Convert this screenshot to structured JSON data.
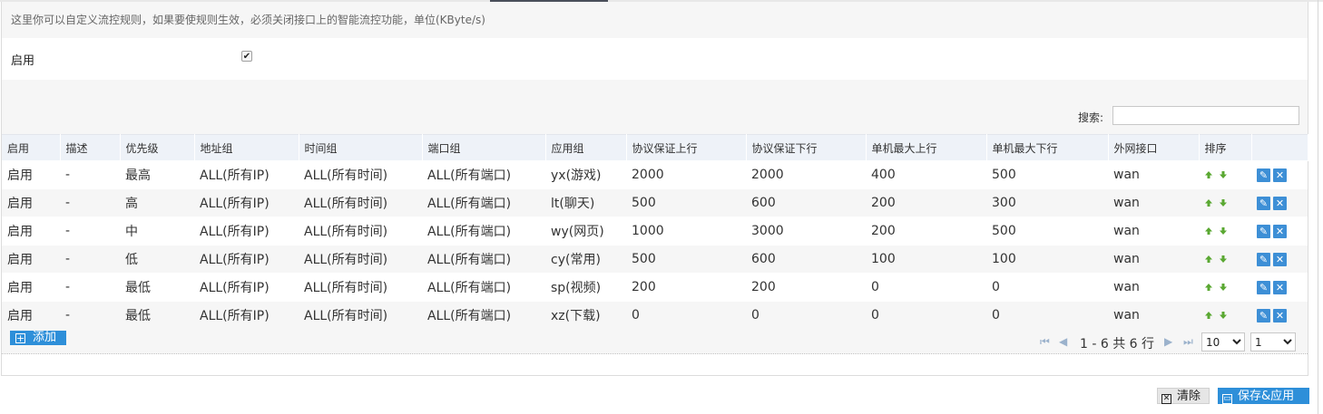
{
  "description": "这里你可以自定义流控规则，如果要使规则生效，必须关闭接口上的智能流控功能，单位(KByte/s)",
  "enable": {
    "label": "启用",
    "checked": true
  },
  "search": {
    "label": "搜索:",
    "value": ""
  },
  "table": {
    "headers": [
      "启用",
      "描述",
      "优先级",
      "地址组",
      "时间组",
      "端口组",
      "应用组",
      "协议保证上行",
      "协议保证下行",
      "单机最大上行",
      "单机最大下行",
      "外网接口",
      "排序"
    ],
    "rows": [
      [
        "启用",
        "-",
        "最高",
        "ALL(所有IP)",
        "ALL(所有时间)",
        "ALL(所有端口)",
        "yx(游戏)",
        "2000",
        "2000",
        "400",
        "500",
        "wan"
      ],
      [
        "启用",
        "-",
        "高",
        "ALL(所有IP)",
        "ALL(所有时间)",
        "ALL(所有端口)",
        "lt(聊天)",
        "500",
        "600",
        "200",
        "300",
        "wan"
      ],
      [
        "启用",
        "-",
        "中",
        "ALL(所有IP)",
        "ALL(所有时间)",
        "ALL(所有端口)",
        "wy(网页)",
        "1000",
        "3000",
        "200",
        "500",
        "wan"
      ],
      [
        "启用",
        "-",
        "低",
        "ALL(所有IP)",
        "ALL(所有时间)",
        "ALL(所有端口)",
        "cy(常用)",
        "500",
        "600",
        "100",
        "100",
        "wan"
      ],
      [
        "启用",
        "-",
        "最低",
        "ALL(所有IP)",
        "ALL(所有时间)",
        "ALL(所有端口)",
        "sp(视频)",
        "200",
        "200",
        "0",
        "0",
        "wan"
      ],
      [
        "启用",
        "-",
        "最低",
        "ALL(所有IP)",
        "ALL(所有时间)",
        "ALL(所有端口)",
        "xz(下载)",
        "0",
        "0",
        "0",
        "0",
        "wan"
      ]
    ]
  },
  "add_label": "添加",
  "pager": {
    "info": "1 - 6 共 6 行",
    "page_size": "10",
    "page": "1"
  },
  "footer": {
    "clear_label": "清除",
    "save_label": "保存&应用"
  },
  "icons": {
    "sort_up": "arrow-up-icon",
    "sort_down": "arrow-down-icon",
    "edit": "pencil-icon",
    "delete": "close-icon",
    "add": "plus-icon",
    "clear": "clear-icon",
    "save": "floppy-icon",
    "first": "first-page-icon",
    "prev": "prev-page-icon",
    "next": "next-page-icon",
    "last": "last-page-icon"
  },
  "colors": {
    "accent": "#2e8fd9",
    "sort_arrow": "#5aa832",
    "header_bg": "#eef2f8"
  }
}
